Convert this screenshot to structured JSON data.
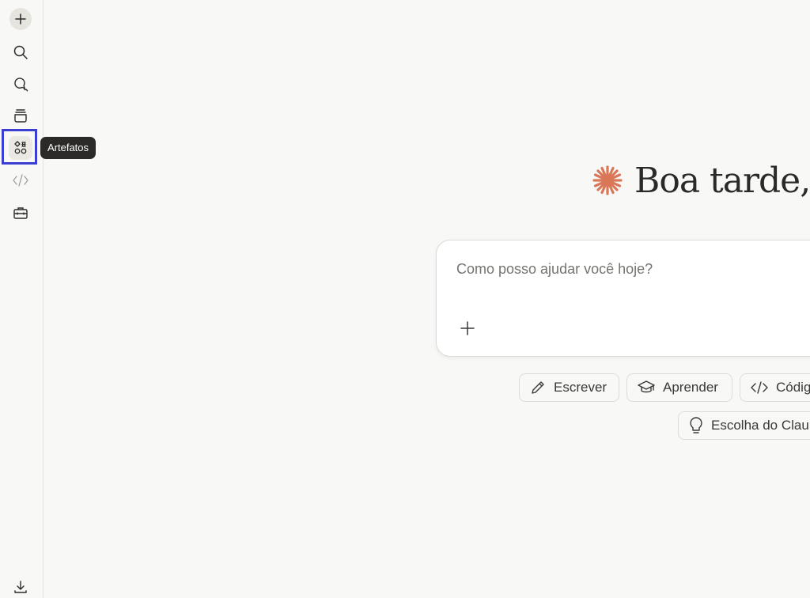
{
  "sidebar": {
    "new_chat": "plus-icon",
    "search": "search-icon",
    "chats": "chats-icon",
    "projects": "projects-icon",
    "artifacts": "artifacts-icon",
    "code": "code-icon",
    "tools": "toolbox-icon",
    "download": "download-icon"
  },
  "tooltip": {
    "label": "Artefatos"
  },
  "greeting": {
    "text": "Boa tarde,"
  },
  "composer": {
    "placeholder": "Como posso ajudar você hoje?",
    "value": ""
  },
  "chips": {
    "write": "Escrever",
    "learn": "Aprender",
    "code": "Códig",
    "claude": "Escolha do Clau"
  },
  "colors": {
    "accent": "#d97757",
    "highlight": "#3b3fd1",
    "background": "#f8f8f6"
  }
}
